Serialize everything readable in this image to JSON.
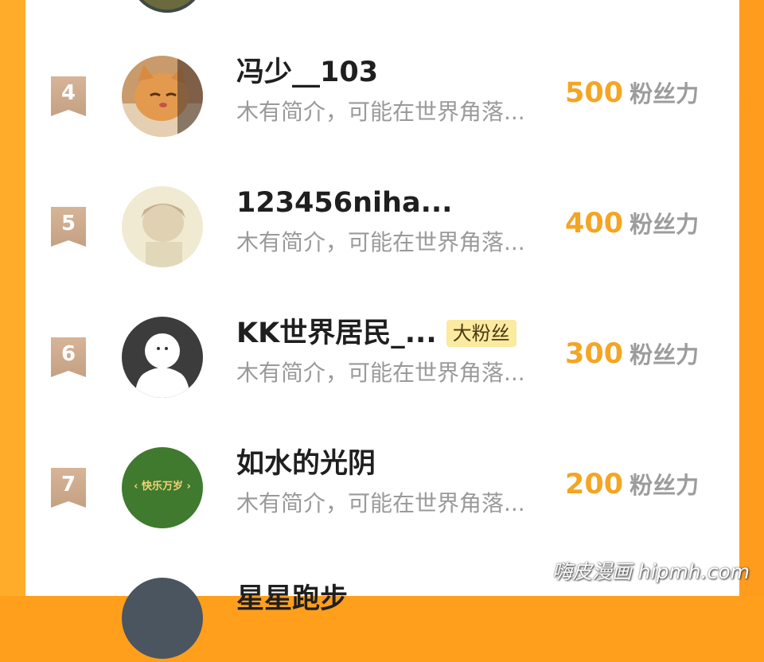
{
  "colors": {
    "frame": "#ff9f1c",
    "score": "#f4a523",
    "rank_ribbon": "#c9a688",
    "badge_bg": "#fbeaa0"
  },
  "rows": [
    {
      "rank": "4",
      "name": "冯少__103",
      "bio": "木有简介，可能在世界角落...",
      "score": "500",
      "unit": "粉丝力",
      "badge": ""
    },
    {
      "rank": "5",
      "name": "123456niha...",
      "bio": "木有简介，可能在世界角落...",
      "score": "400",
      "unit": "粉丝力",
      "badge": ""
    },
    {
      "rank": "6",
      "name": "KK世界居民_...",
      "bio": "木有简介，可能在世界角落...",
      "score": "300",
      "unit": "粉丝力",
      "badge": "大粉丝"
    },
    {
      "rank": "7",
      "name": "如水的光阴",
      "bio": "木有简介，可能在世界角落...",
      "score": "200",
      "unit": "粉丝力",
      "badge": ""
    },
    {
      "rank": "",
      "name": "星星跑步",
      "bio": "",
      "score": "",
      "unit": "",
      "badge": ""
    }
  ],
  "avatar_texts": {
    "row7": "‹ 快乐万岁 ›"
  },
  "watermark": "嗨皮漫画 hipmh.com"
}
